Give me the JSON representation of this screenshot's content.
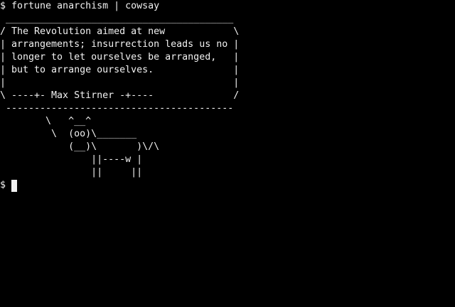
{
  "terminal": {
    "command_line": "$ fortune anarchism | cowsay",
    "output": [
      " ________________________________________",
      "/ The Revolution aimed at new            \\",
      "| arrangements; insurrection leads us no |",
      "| longer to let ourselves be arranged,   |",
      "| but to arrange ourselves.              |",
      "|                                        |",
      "\\ ----+- Max Stirner -+----              /",
      " ----------------------------------------",
      "        \\   ^__^",
      "         \\  (oo)\\_______",
      "            (__)\\       )\\/\\",
      "                ||----w |",
      "                ||     ||"
    ],
    "prompt": "$ ",
    "colors": {
      "background": "#000000",
      "foreground": "#f2f2f2"
    }
  }
}
